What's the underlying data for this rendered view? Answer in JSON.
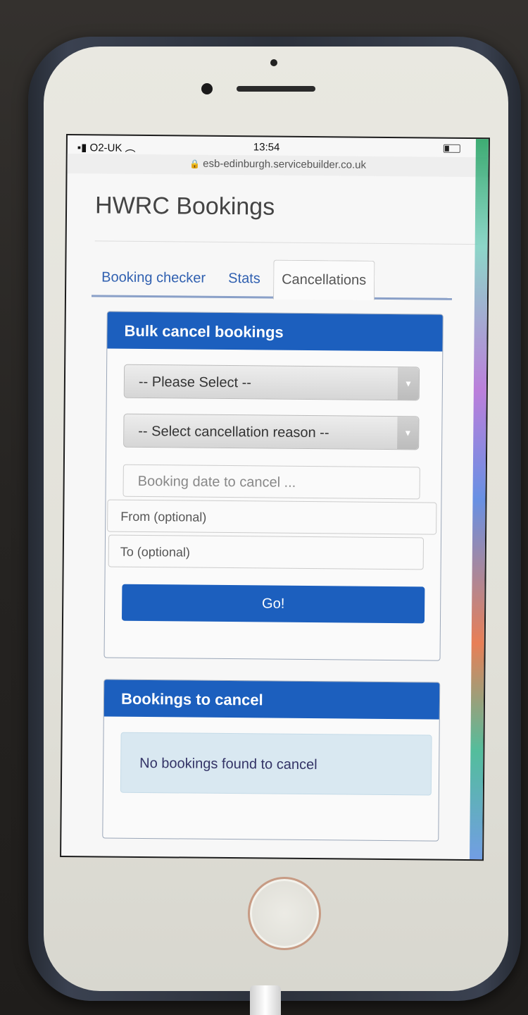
{
  "status_bar": {
    "carrier": "O2-UK",
    "time": "13:54"
  },
  "url_bar": {
    "lock_icon": "lock-icon",
    "url": "esb-edinburgh.servicebuilder.co.uk"
  },
  "page": {
    "title": "HWRC Bookings"
  },
  "tabs": [
    {
      "label": "Booking checker"
    },
    {
      "label": "Stats"
    },
    {
      "label": "Cancellations"
    }
  ],
  "bulk_cancel": {
    "header": "Bulk cancel bookings",
    "site_select": "-- Please Select --",
    "reason_select": "-- Select cancellation reason --",
    "date_placeholder": "Booking date to cancel ...",
    "from_placeholder": "From (optional)",
    "to_placeholder": "To (optional)",
    "go_label": "Go!"
  },
  "bookings_to_cancel": {
    "header": "Bookings to cancel",
    "empty_message": "No bookings found to cancel"
  },
  "colors": {
    "primary": "#1c5fbe",
    "alert_bg": "#d9e8f1"
  }
}
